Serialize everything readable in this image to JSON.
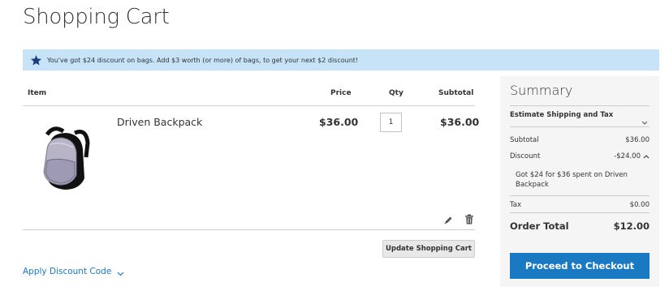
{
  "page": {
    "title": "Shopping Cart"
  },
  "notice": {
    "icon": "star-icon",
    "message": "You've got $24 discount on bags. Add $3 worth (or more) of bags, to get your next $2 discount!"
  },
  "cart": {
    "headers": {
      "item": "Item",
      "price": "Price",
      "qty": "Qty",
      "subtotal": "Subtotal"
    },
    "items": [
      {
        "name": "Driven Backpack",
        "price": "$36.00",
        "qty": "1",
        "subtotal": "$36.00"
      }
    ],
    "update_label": "Update Shopping Cart"
  },
  "discount": {
    "label": "Apply Discount Code"
  },
  "summary": {
    "title": "Summary",
    "estimate_label": "Estimate Shipping and Tax",
    "subtotal_label": "Subtotal",
    "subtotal_value": "$36.00",
    "discount_label": "Discount",
    "discount_value": "-$24.00",
    "discount_note": "Got $24 for $36 spent on Driven Backpack",
    "tax_label": "Tax",
    "tax_value": "$0.00",
    "order_total_label": "Order Total",
    "order_total_value": "$12.00",
    "checkout_label": "Proceed to Checkout"
  },
  "colors": {
    "accent": "#1979c3",
    "notice_bg": "#c6e3f8",
    "summary_bg": "#f5f5f5"
  }
}
